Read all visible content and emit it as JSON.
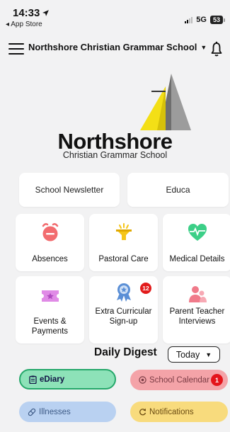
{
  "status_bar": {
    "time": "14:33",
    "back_app": "◂ App Store",
    "network": "5G",
    "battery": "53"
  },
  "header": {
    "school_name": "Northshore Christian Grammar School"
  },
  "logo": {
    "title": "Northshore",
    "subtitle": "Christian Grammar School"
  },
  "links": [
    {
      "label": "School Newsletter"
    },
    {
      "label": "Educa"
    }
  ],
  "tiles": [
    {
      "label": "Absences",
      "icon": "alarm-clock-icon",
      "color": "#f26c6f"
    },
    {
      "label": "Pastoral Care",
      "icon": "funnel-icon",
      "color": "#f5c518"
    },
    {
      "label": "Medical Details",
      "icon": "heart-pulse-icon",
      "color": "#3ccf87"
    },
    {
      "label": "Events & Payments",
      "icon": "ticket-icon",
      "color": "#e08be6"
    },
    {
      "label": "Extra Curricular Sign-up",
      "icon": "award-ribbon-icon",
      "color": "#5b8fd6",
      "badge": "12"
    },
    {
      "label": "Parent Teacher Interviews",
      "icon": "people-icon",
      "color": "#f07a8a"
    }
  ],
  "digest": {
    "title": "Daily Digest",
    "filter": "Today"
  },
  "pills": {
    "ediary": "eDiary",
    "calendar": "School Calendar",
    "calendar_badge": "1",
    "illnesses": "Illnesses",
    "notifications": "Notifications"
  }
}
